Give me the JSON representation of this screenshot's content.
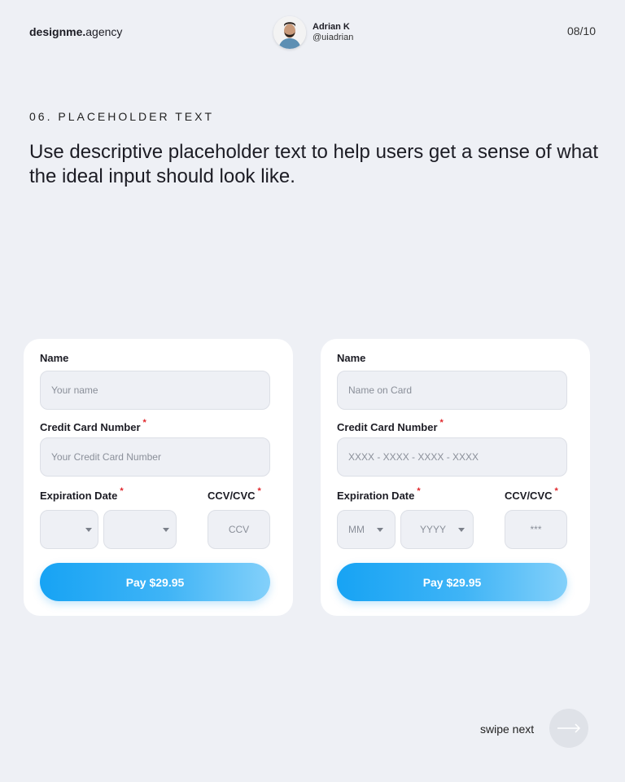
{
  "brand": {
    "bold": "designme.",
    "regular": "agency"
  },
  "author": {
    "name": "Adrian K",
    "handle": "@uiadrian"
  },
  "page": {
    "number": "08/10"
  },
  "section": {
    "label": "06. PLACEHOLDER TEXT"
  },
  "headline": "Use descriptive placeholder text to help users get a sense of what the ideal input should look like.",
  "required_mark": "*",
  "cards": {
    "left": {
      "name_label": "Name",
      "name_placeholder": "Your name",
      "card_label": "Credit Card Number",
      "card_placeholder": "Your Credit Card Number",
      "exp_label": "Expiration Date",
      "month_placeholder": "",
      "year_placeholder": "",
      "cvv_label": "CCV/CVC",
      "cvv_placeholder": "CCV",
      "pay_label": "Pay $29.95"
    },
    "right": {
      "name_label": "Name",
      "name_placeholder": "Name on Card",
      "card_label": "Credit Card Number",
      "card_placeholder": "XXXX - XXXX - XXXX - XXXX",
      "exp_label": "Expiration Date",
      "month_placeholder": "MM",
      "year_placeholder": "YYYY",
      "cvv_label": "CCV/CVC",
      "cvv_placeholder": "***",
      "pay_label": "Pay $29.95"
    }
  },
  "footer": {
    "swipe_label": "swipe next"
  },
  "colors": {
    "accent": "#17a3f4",
    "required": "#e0262b",
    "background": "#eef0f5"
  },
  "icons": {
    "next": "arrow-right-icon",
    "dropdown": "chevron-down-icon"
  }
}
